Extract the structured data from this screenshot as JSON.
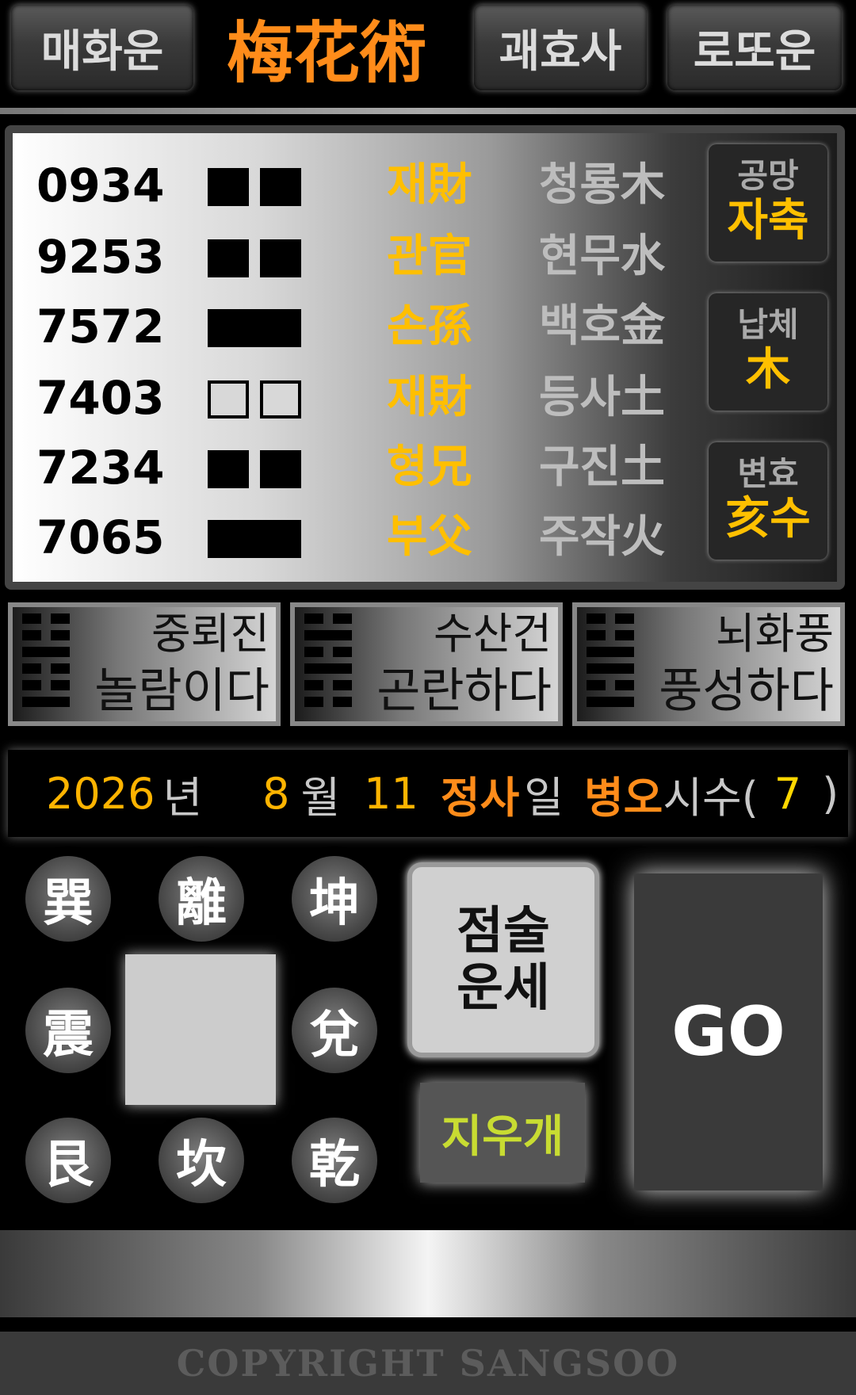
{
  "top": {
    "left_button": "매화운",
    "title": "梅花術",
    "mid_button": "괘효사",
    "right_button": "로또운"
  },
  "lines": [
    {
      "number": "0934",
      "type": "yin",
      "relation": "재財",
      "god": "청룡木"
    },
    {
      "number": "9253",
      "type": "yin",
      "relation": "관官",
      "god": "현무水"
    },
    {
      "number": "7572",
      "type": "yang",
      "relation": "손孫",
      "god": "백호金"
    },
    {
      "number": "7403",
      "type": "yin-changing",
      "relation": "재財",
      "god": "등사土"
    },
    {
      "number": "7234",
      "type": "yin",
      "relation": "형兄",
      "god": "구진土"
    },
    {
      "number": "7065",
      "type": "yang",
      "relation": "부父",
      "god": "주작火"
    }
  ],
  "side": [
    {
      "title": "공망",
      "value": "자축"
    },
    {
      "title": "납체",
      "value": "木"
    },
    {
      "title": "변효",
      "value": "亥수"
    }
  ],
  "gua": [
    {
      "name": "중뢰진",
      "desc": "놀람이다",
      "lines": [
        "yin",
        "yin",
        "yang",
        "yin",
        "yin",
        "yang"
      ]
    },
    {
      "name": "수산건",
      "desc": "곤란하다",
      "lines": [
        "yin",
        "yang",
        "yin",
        "yang",
        "yin",
        "yin"
      ]
    },
    {
      "name": "뇌화풍",
      "desc": "풍성하다",
      "lines": [
        "yin",
        "yin",
        "yang",
        "yang",
        "yin",
        "yang"
      ]
    }
  ],
  "date": {
    "year": "2026",
    "year_unit": "년",
    "month": "8",
    "month_unit": "월",
    "day": "11",
    "day_gz": "정사",
    "day_unit": "일",
    "hour_gz": "병오",
    "hour_unit": "시수(",
    "count": "7",
    "close": ")",
    "colors": {
      "number": "#ffb400",
      "ganzhi": "#ff8c1a",
      "unit": "#c8c8c8",
      "count": "#ffd700"
    }
  },
  "bagua": {
    "xun": "巽",
    "li": "離",
    "kun": "坤",
    "zhen": "震",
    "dui": "兌",
    "gen": "艮",
    "kan": "坎",
    "qian": "乾"
  },
  "buttons": {
    "fortune_line1": "점술",
    "fortune_line2": "운세",
    "erase": "지우개",
    "go": "GO"
  },
  "footer": "COPYRIGHT SANGSOO"
}
